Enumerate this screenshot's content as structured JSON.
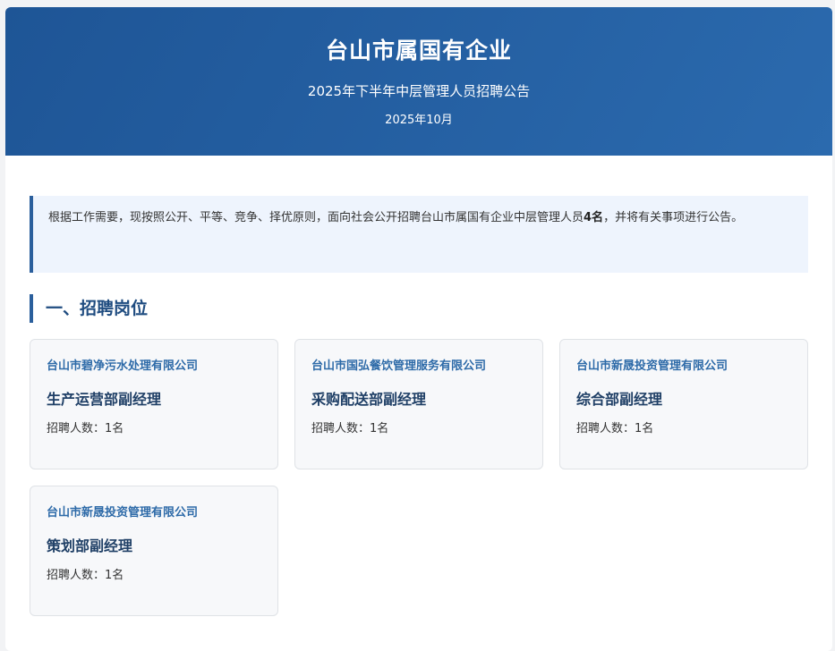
{
  "header": {
    "title": "台山市属国有企业",
    "subtitle": "2025年下半年中层管理人员招聘公告",
    "date": "2025年10月"
  },
  "intro": {
    "text_before": "根据工作需要，现按照公开、平等、竞争、择优原则，面向社会公开招聘台山市属国有企业中层管理人员",
    "count": "4名",
    "text_after": "，并将有关事项进行公告。"
  },
  "section": {
    "title": "一、招聘岗位"
  },
  "positions": [
    {
      "company": "台山市碧净污水处理有限公司",
      "title": "生产运营部副经理",
      "count": "招聘人数：1名"
    },
    {
      "company": "台山市国弘餐饮管理服务有限公司",
      "title": "采购配送部副经理",
      "count": "招聘人数：1名"
    },
    {
      "company": "台山市新晟投资管理有限公司",
      "title": "综合部副经理",
      "count": "招聘人数：1名"
    },
    {
      "company": "台山市新晟投资管理有限公司",
      "title": "策划部副经理",
      "count": "招聘人数：1名"
    }
  ],
  "colors": {
    "header_bg": "#1e5596",
    "accent": "#2b5f9c",
    "company_text": "#2d6aa8",
    "intro_bg": "#eef4fd"
  }
}
